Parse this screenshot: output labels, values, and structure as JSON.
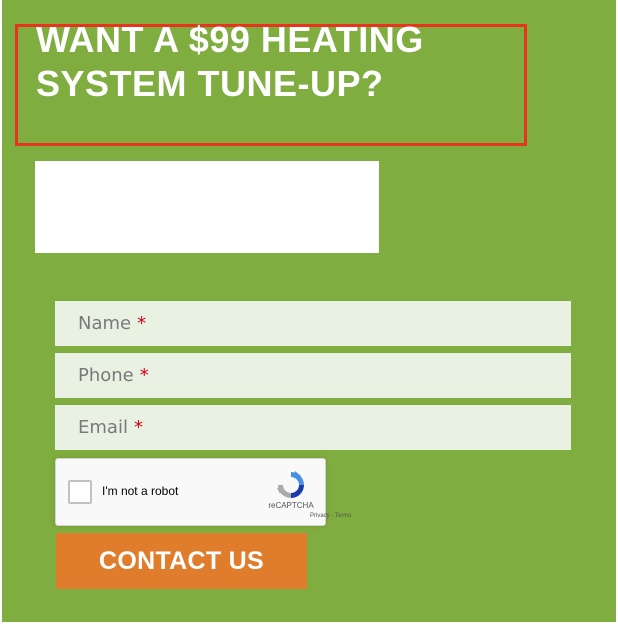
{
  "headline": {
    "line1": "WANT A $99 HEATING",
    "line2": "SYSTEM TUNE-UP?"
  },
  "form": {
    "fields": [
      {
        "placeholder": "Name",
        "required_mark": "*"
      },
      {
        "placeholder": "Phone",
        "required_mark": "*"
      },
      {
        "placeholder": "Email",
        "required_mark": "*"
      }
    ],
    "recaptcha": {
      "label": "I'm not a robot",
      "brand": "reCAPTCHA",
      "terms": "Privacy - Terms",
      "icon": "recaptcha-logo-icon"
    },
    "submit_label": "CONTACT US"
  },
  "colors": {
    "panel_background": "#80ad3f",
    "highlight_border": "#e8341c",
    "field_background": "#e9f1e2",
    "button_background": "#e07d2c",
    "required_mark": "#d0021b"
  }
}
